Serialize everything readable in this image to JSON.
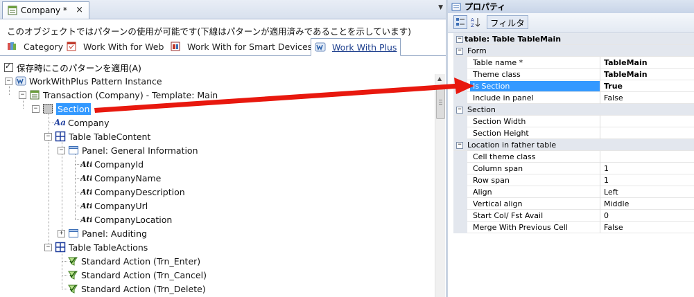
{
  "document_tab": {
    "title": "Company *",
    "close_glyph": "×"
  },
  "pattern_info": "このオブジェクトではパターンの使用が可能です(下線はパターンが適用済みであることを示しています)",
  "pattern_tabs": [
    {
      "label": "Category",
      "icon": "category-icon"
    },
    {
      "label": "Work With for Web",
      "icon": "web-form-icon"
    },
    {
      "label": "Work With for Smart Devices",
      "icon": "smart-device-icon"
    },
    {
      "label": "Work With Plus",
      "icon": "workwithplus-icon",
      "active": true
    }
  ],
  "apply_checkbox": {
    "label": "保存時にこのパターンを適用(A)",
    "checked": true
  },
  "tree": {
    "root": "WorkWithPlus Pattern Instance",
    "transaction": "Transaction (Company) - Template: Main",
    "section": "Section",
    "company_text": "Company",
    "table_content": "Table TableContent",
    "panel_general": "Panel: General Information",
    "attributes": [
      "CompanyId",
      "CompanyName",
      "CompanyDescription",
      "CompanyUrl",
      "CompanyLocation"
    ],
    "panel_auditing": "Panel: Auditing",
    "table_actions": "Table TableActions",
    "actions": [
      "Standard Action (Trn_Enter)",
      "Standard Action (Trn_Cancel)",
      "Standard Action (Trn_Delete)"
    ]
  },
  "properties": {
    "title": "プロパティ",
    "filter_label": "フィルタ",
    "header": "table: Table TableMain",
    "categories": {
      "form": "Form",
      "section": "Section",
      "location": "Location in father table"
    },
    "rows": {
      "table_name": {
        "name": "Table name *",
        "value": "TableMain"
      },
      "theme_class": {
        "name": "Theme class",
        "value": "TableMain"
      },
      "is_section": {
        "name": "Is Section",
        "value": "True"
      },
      "include_in_panel": {
        "name": "Include in panel",
        "value": "False"
      },
      "section_width": {
        "name": "Section Width",
        "value": ""
      },
      "section_height": {
        "name": "Section Height",
        "value": ""
      },
      "cell_theme_class": {
        "name": "Cell theme class",
        "value": ""
      },
      "column_span": {
        "name": "Column span",
        "value": "1"
      },
      "row_span": {
        "name": "Row span",
        "value": "1"
      },
      "align": {
        "name": "Align",
        "value": "Left"
      },
      "vertical_align": {
        "name": "Vertical align",
        "value": "Middle"
      },
      "start_col": {
        "name": "Start Col/ Fst Avail",
        "value": "0"
      },
      "merge_previous": {
        "name": "Merge With Previous Cell",
        "value": "False"
      }
    }
  },
  "colors": {
    "selection": "#3399ff",
    "arrow": "#e8180e",
    "tab_link": "#1a3c8c"
  }
}
